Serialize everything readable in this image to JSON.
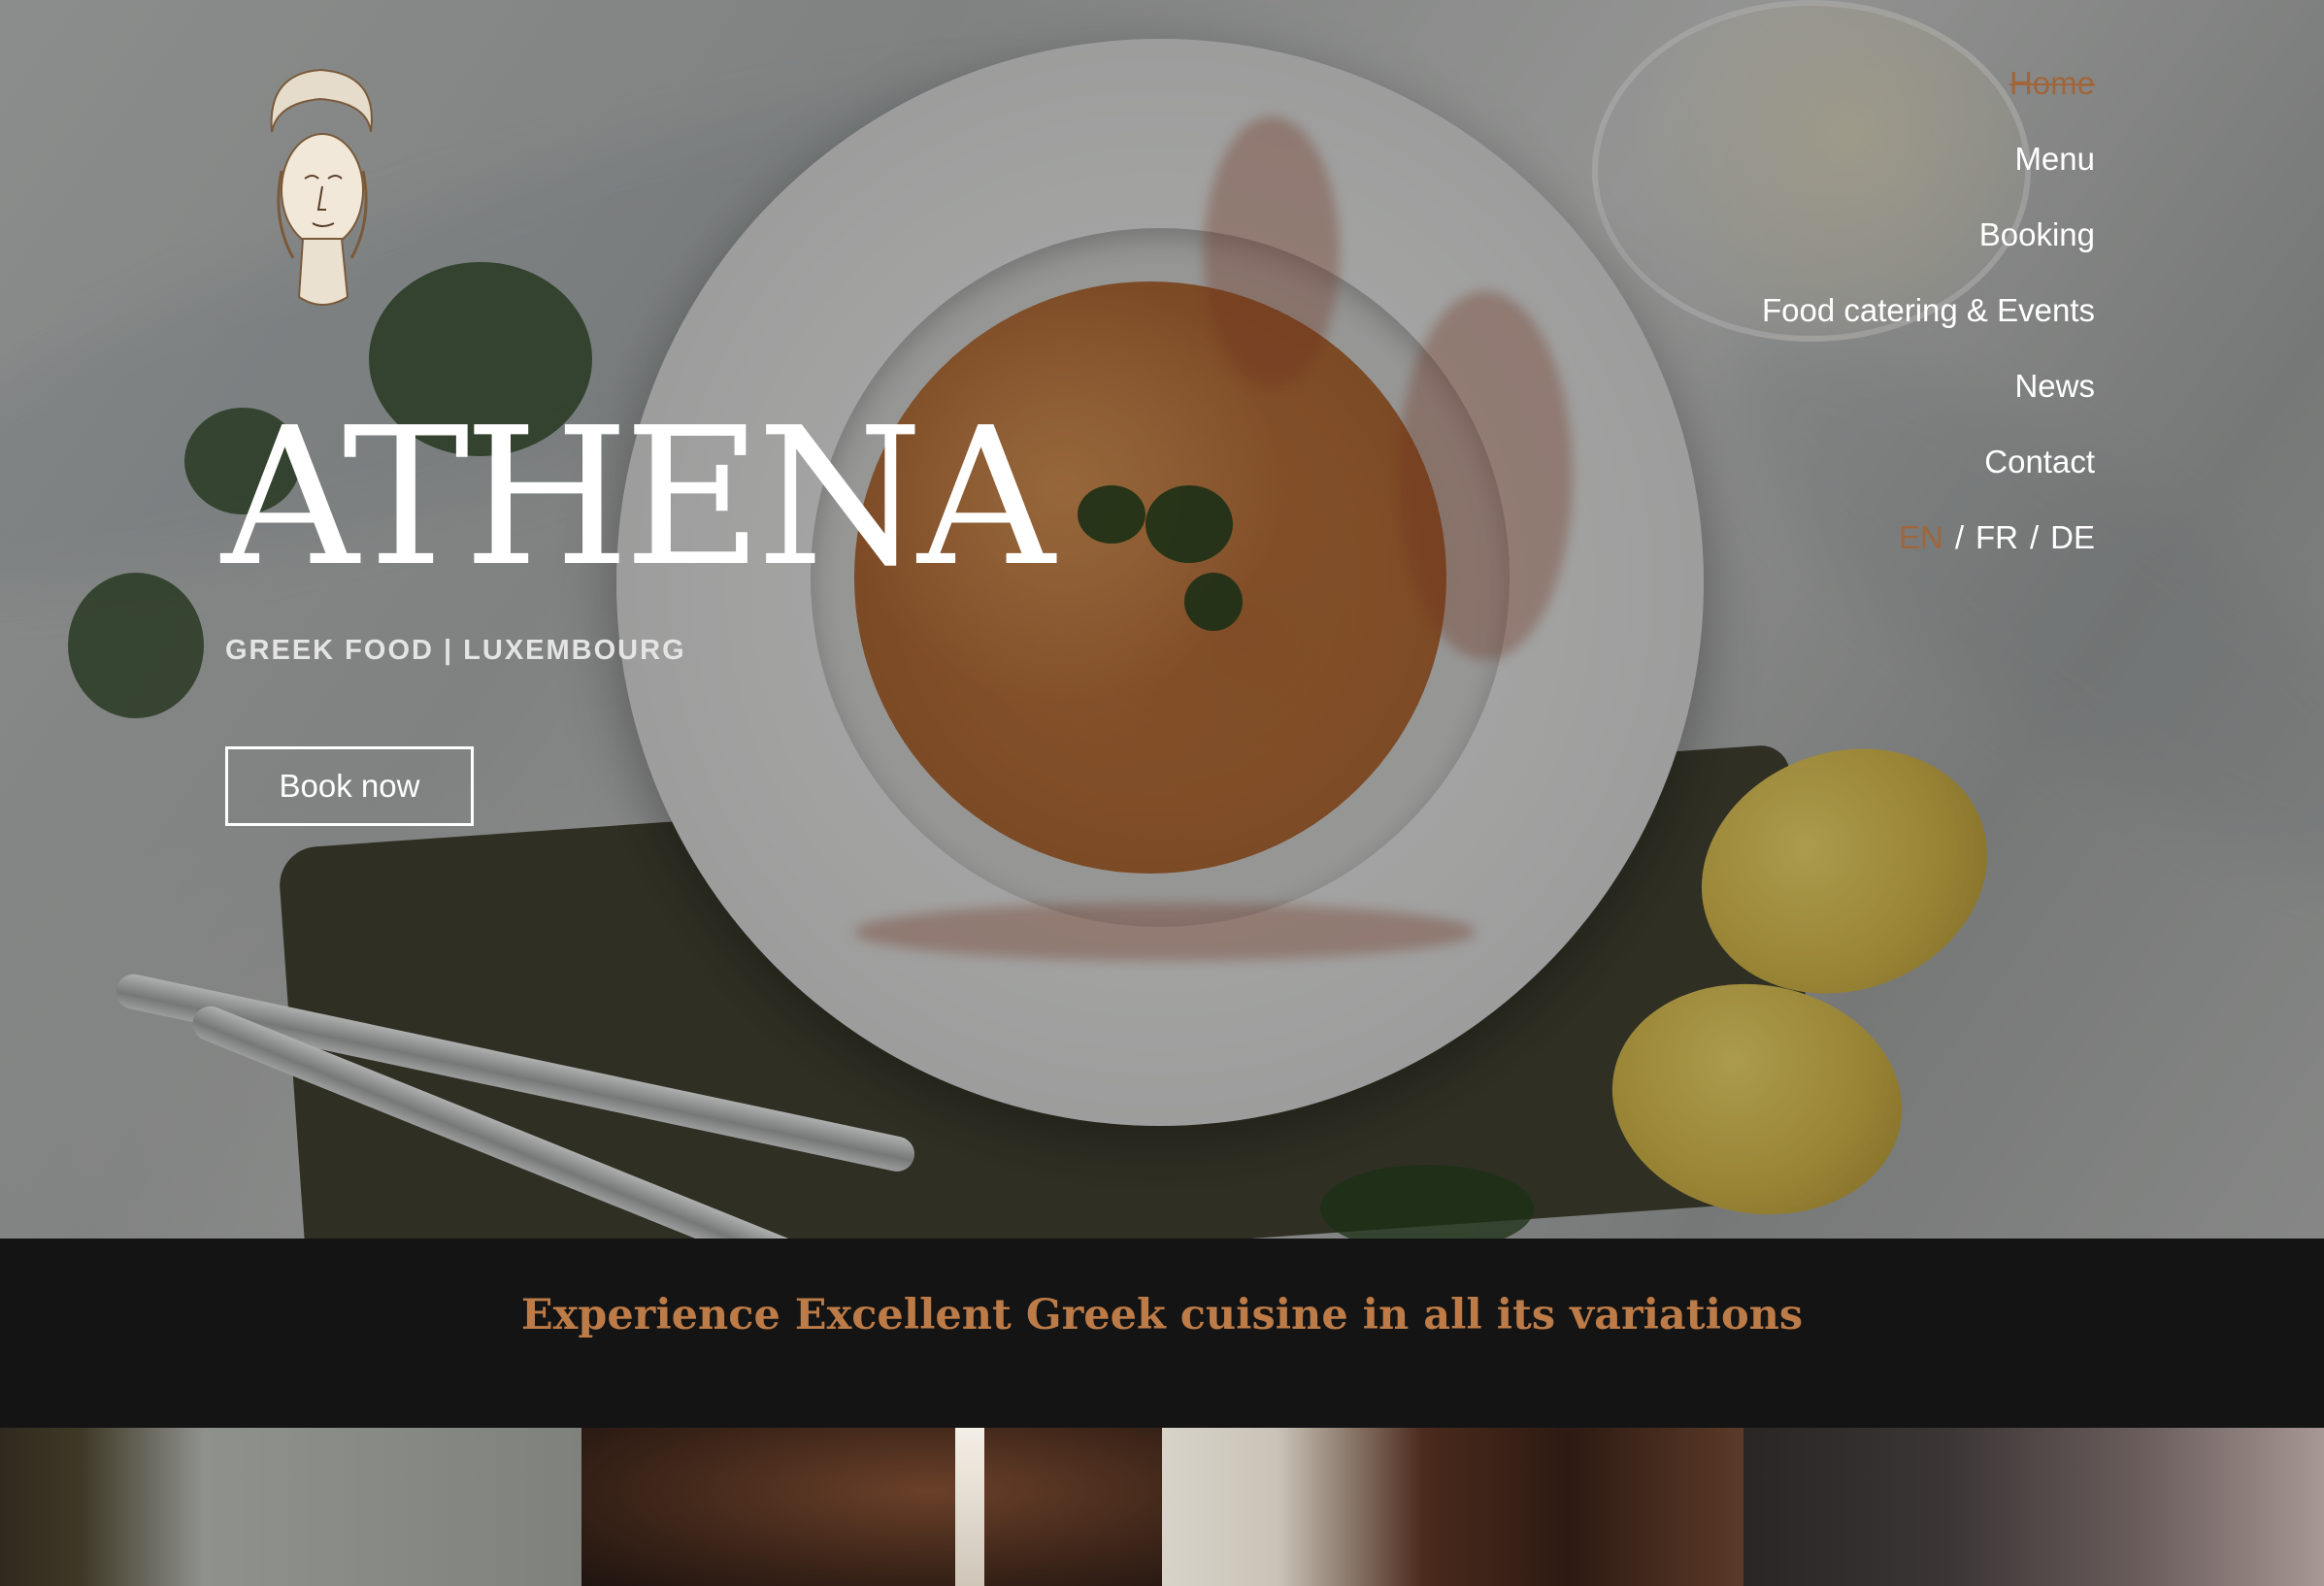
{
  "brand": {
    "name": "ATHENA",
    "subtitle": "GREEK FOOD | LUXEMBOURG"
  },
  "hero": {
    "book_button": "Book now"
  },
  "nav": {
    "items": [
      {
        "label": "Home",
        "active": true
      },
      {
        "label": "Menu",
        "active": false
      },
      {
        "label": "Booking",
        "active": false
      },
      {
        "label": "Food catering & Events",
        "active": false
      },
      {
        "label": "News",
        "active": false
      },
      {
        "label": "Contact",
        "active": false
      }
    ],
    "languages": [
      {
        "label": "EN",
        "active": true
      },
      {
        "label": "FR",
        "active": false
      },
      {
        "label": "DE",
        "active": false
      }
    ],
    "lang_separator": "/"
  },
  "band": {
    "tagline": "Experience Excellent Greek cuisine in all its variations"
  },
  "colors": {
    "accent": "#a0663b",
    "tagline": "#bd7b47",
    "band_background": "#141414",
    "text_light": "#ffffff"
  },
  "icons": [
    "greek-goddess-bust-icon"
  ]
}
